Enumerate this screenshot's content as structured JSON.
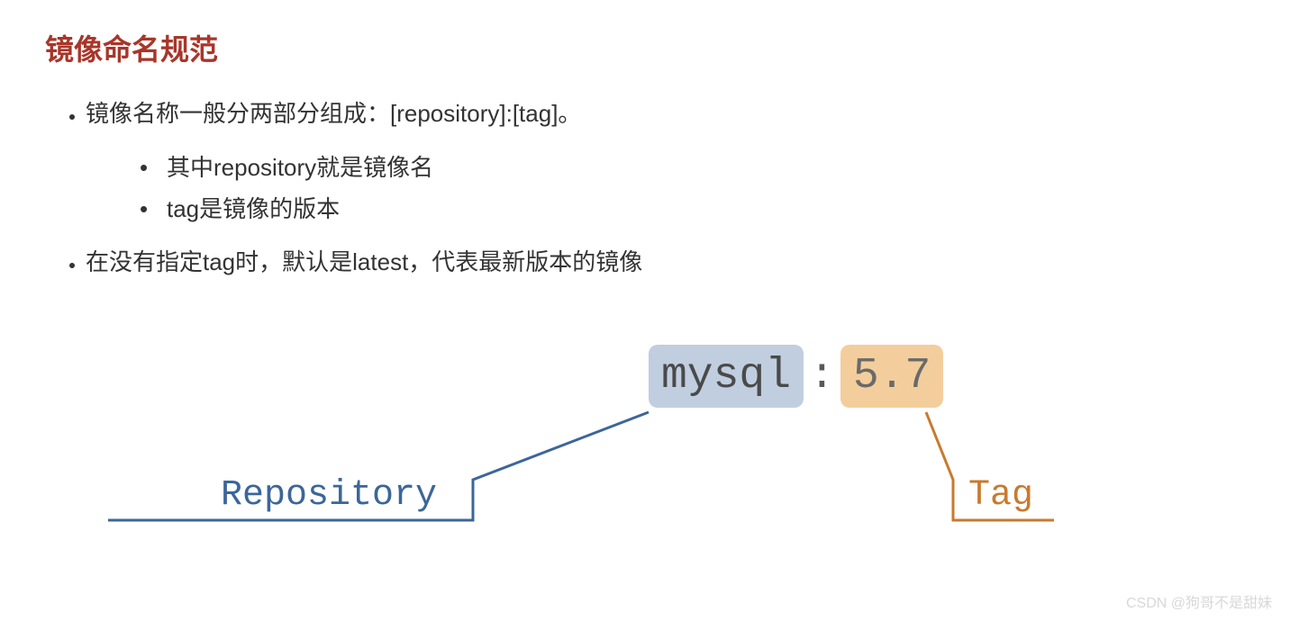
{
  "title": "镜像命名规范",
  "bullets": {
    "b1": "镜像名称一般分两部分组成：[repository]:[tag]。",
    "b1_sub1": "其中repository就是镜像名",
    "b1_sub2": "tag是镜像的版本",
    "b2": "在没有指定tag时，默认是latest，代表最新版本的镜像"
  },
  "example": {
    "repo": "mysql",
    "colon": ":",
    "tag": "5.7"
  },
  "labels": {
    "repo": "Repository",
    "tag": "Tag"
  },
  "watermark": "CSDN @狗哥不是甜妹"
}
